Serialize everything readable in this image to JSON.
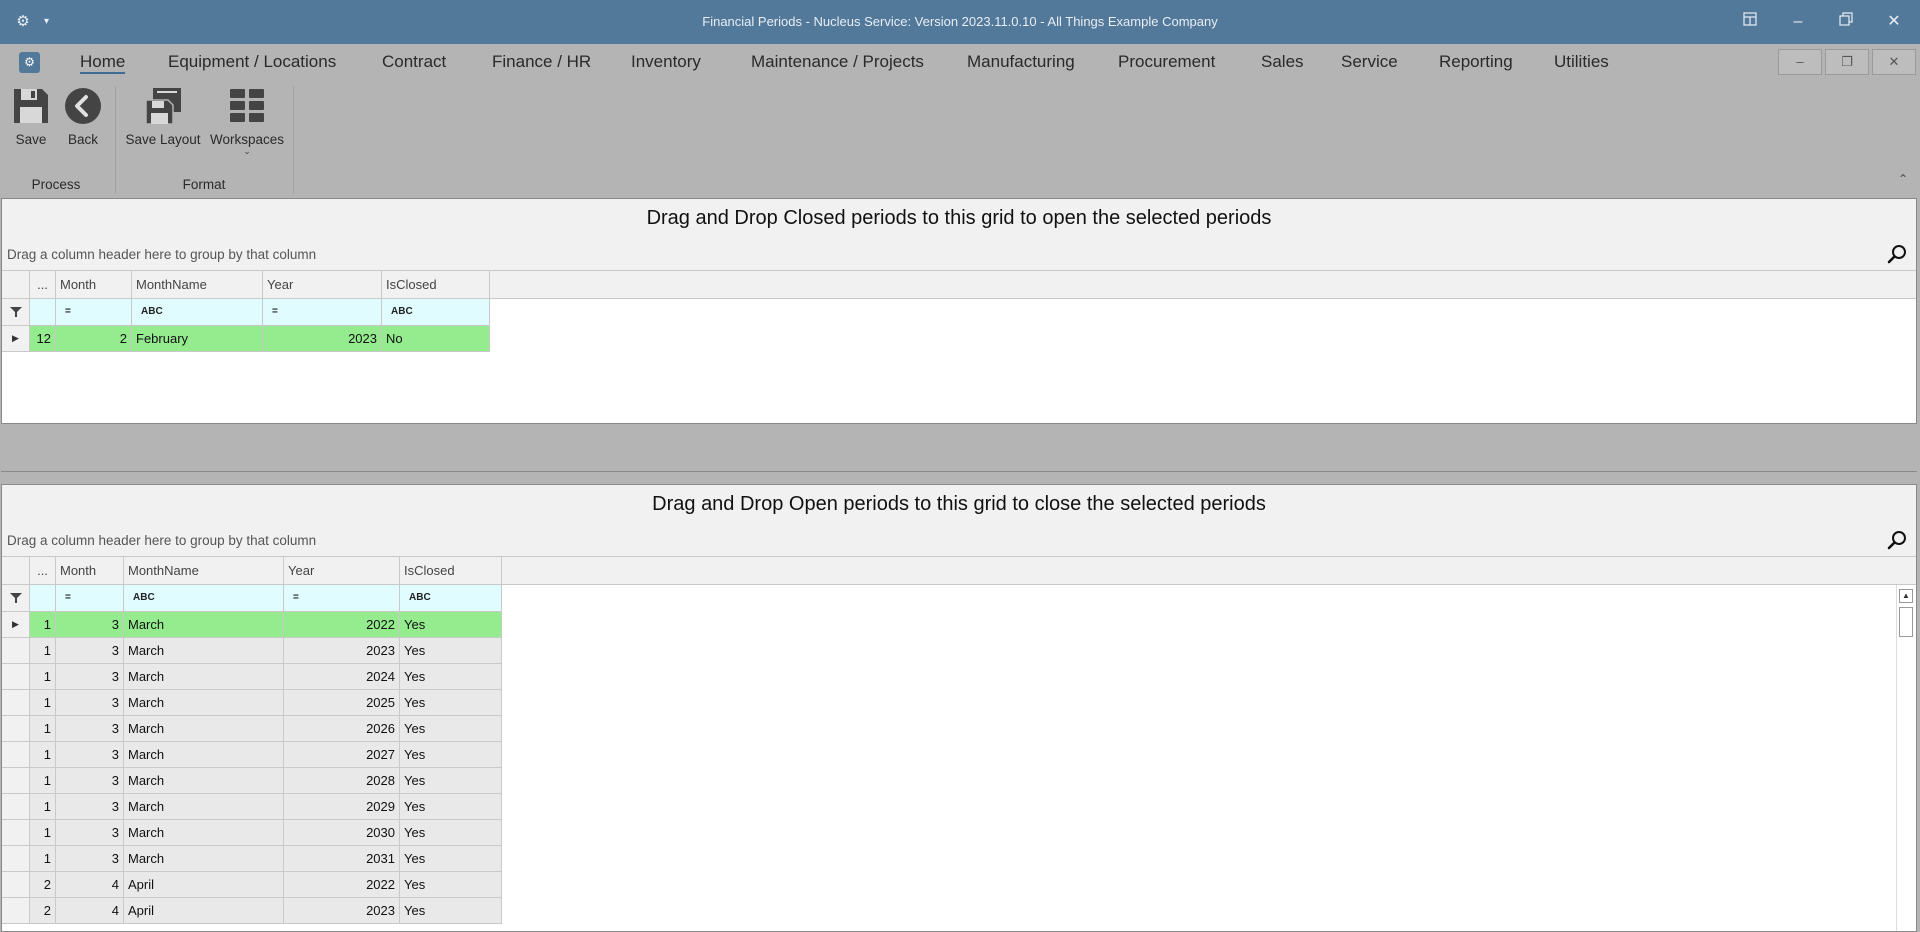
{
  "window": {
    "title": "Financial Periods - Nucleus Service: Version 2023.11.0.10 - All Things Example Company"
  },
  "ribbon_tabs": [
    {
      "label": "Home",
      "active": true
    },
    {
      "label": "Equipment / Locations"
    },
    {
      "label": "Contract"
    },
    {
      "label": "Finance / HR"
    },
    {
      "label": "Inventory"
    },
    {
      "label": "Maintenance / Projects"
    },
    {
      "label": "Manufacturing"
    },
    {
      "label": "Procurement"
    },
    {
      "label": "Sales"
    },
    {
      "label": "Service"
    },
    {
      "label": "Reporting"
    },
    {
      "label": "Utilities"
    }
  ],
  "ribbon": {
    "save_label": "Save",
    "back_label": "Back",
    "save_layout_label": "Save Layout",
    "workspaces_label": "Workspaces",
    "group_process": "Process",
    "group_format": "Format"
  },
  "grid_top": {
    "title": "Drag and Drop Closed periods to this grid to open the selected periods",
    "group_hint": "Drag a column header here to group by that column",
    "columns": [
      "...",
      "Month",
      "MonthName",
      "Year",
      "IsClosed"
    ],
    "filters": [
      "=",
      "ABC",
      "=",
      "ABC"
    ],
    "rows": [
      {
        "count": "12",
        "month": "2",
        "monthname": "February",
        "year": "2023",
        "isclosed": "No",
        "selected": true
      }
    ]
  },
  "grid_bottom": {
    "title": "Drag and Drop Open periods to this grid to close the selected periods",
    "group_hint": "Drag a column header here to group by that column",
    "columns": [
      "...",
      "Month",
      "MonthName",
      "Year",
      "IsClosed"
    ],
    "filters": [
      "=",
      "ABC",
      "=",
      "ABC"
    ],
    "rows": [
      {
        "count": "1",
        "month": "3",
        "monthname": "March",
        "year": "2022",
        "isclosed": "Yes",
        "selected": true
      },
      {
        "count": "1",
        "month": "3",
        "monthname": "March",
        "year": "2023",
        "isclosed": "Yes"
      },
      {
        "count": "1",
        "month": "3",
        "monthname": "March",
        "year": "2024",
        "isclosed": "Yes"
      },
      {
        "count": "1",
        "month": "3",
        "monthname": "March",
        "year": "2025",
        "isclosed": "Yes"
      },
      {
        "count": "1",
        "month": "3",
        "monthname": "March",
        "year": "2026",
        "isclosed": "Yes"
      },
      {
        "count": "1",
        "month": "3",
        "monthname": "March",
        "year": "2027",
        "isclosed": "Yes"
      },
      {
        "count": "1",
        "month": "3",
        "monthname": "March",
        "year": "2028",
        "isclosed": "Yes"
      },
      {
        "count": "1",
        "month": "3",
        "monthname": "March",
        "year": "2029",
        "isclosed": "Yes"
      },
      {
        "count": "1",
        "month": "3",
        "monthname": "March",
        "year": "2030",
        "isclosed": "Yes"
      },
      {
        "count": "1",
        "month": "3",
        "monthname": "March",
        "year": "2031",
        "isclosed": "Yes"
      },
      {
        "count": "2",
        "month": "4",
        "monthname": "April",
        "year": "2022",
        "isclosed": "Yes"
      },
      {
        "count": "2",
        "month": "4",
        "monthname": "April",
        "year": "2023",
        "isclosed": "Yes"
      }
    ]
  },
  "colors": {
    "titlebar": "#52789a",
    "selected_row": "#95ec8f",
    "filter_row": "#e0fcff",
    "row_bg": "#e9e9e9"
  },
  "icons": {
    "app": "gear-icon",
    "save": "floppy-disk-icon",
    "back": "back-arrow-icon",
    "save_layout": "save-layout-icon",
    "workspaces": "grid-icon",
    "search": "magnifier-icon",
    "filter": "funnel-icon"
  }
}
